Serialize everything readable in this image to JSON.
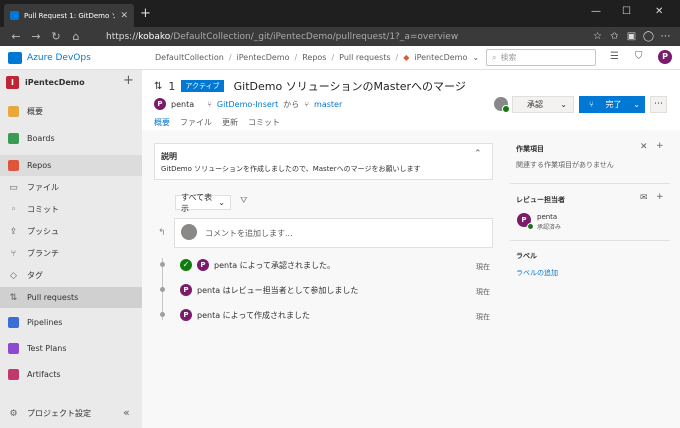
{
  "browser": {
    "tab_title": "Pull Request 1: GitDemo ソリュー",
    "url_host": "kobako",
    "url_path": "/DefaultCollection/_git/iPentecDemo/pullrequest/1?_a=overview",
    "url_prefix": "https://"
  },
  "header": {
    "brand": "Azure DevOps",
    "breadcrumbs": [
      "DefaultCollection",
      "iPentecDemo",
      "Repos",
      "Pull requests",
      "iPentecDemo"
    ],
    "search_placeholder": "検索",
    "user_initial": "P"
  },
  "sidebar": {
    "project_name": "iPentecDemo",
    "project_initial": "I",
    "items": [
      {
        "label": "概要",
        "color": "#e8a93b"
      },
      {
        "label": "Boards",
        "color": "#3a9b55"
      },
      {
        "label": "Repos",
        "color": "#e0543b"
      },
      {
        "label": "ファイル",
        "icon": "📄"
      },
      {
        "label": "コミット",
        "icon": "◈"
      },
      {
        "label": "プッシュ",
        "icon": "⇪"
      },
      {
        "label": "ブランチ",
        "icon": "⑂"
      },
      {
        "label": "タグ",
        "icon": "◇"
      },
      {
        "label": "Pull requests",
        "icon": "⇅"
      },
      {
        "label": "Pipelines",
        "color": "#3a6ed6"
      },
      {
        "label": "Test Plans",
        "color": "#8c4ad3"
      },
      {
        "label": "Artifacts",
        "color": "#c2386d"
      }
    ],
    "footer_label": "プロジェクト設定"
  },
  "pr": {
    "number": "1",
    "status": "アクティブ",
    "title": "GitDemo ソリューションのMasterへのマージ",
    "author": "penta",
    "source_branch": "GitDemo-Insert",
    "from_word": "から",
    "target_branch": "master",
    "tabs": [
      "概要",
      "ファイル",
      "更新",
      "コミット"
    ],
    "approve_label": "承認",
    "complete_label": "完了"
  },
  "description": {
    "heading": "説明",
    "text": "GitDemo ソリューションを作成しましたので、Masterへのマージをお願いします"
  },
  "activity": {
    "filter_label": "すべて表示",
    "comment_placeholder": "コメントを追加します...",
    "items": [
      {
        "text": "penta によって承認されました。",
        "time": "現在"
      },
      {
        "text": "penta はレビュー担当者として参加しました",
        "time": "現在"
      },
      {
        "text": "penta によって作成されました",
        "time": "現在"
      }
    ]
  },
  "right_panel": {
    "work_items_heading": "作業項目",
    "work_items_empty": "関連する作業項目がありません",
    "reviewers_heading": "レビュー担当者",
    "reviewer_name": "penta",
    "reviewer_status": "承認済み",
    "labels_heading": "ラベル",
    "labels_add": "ラベルの追加"
  }
}
